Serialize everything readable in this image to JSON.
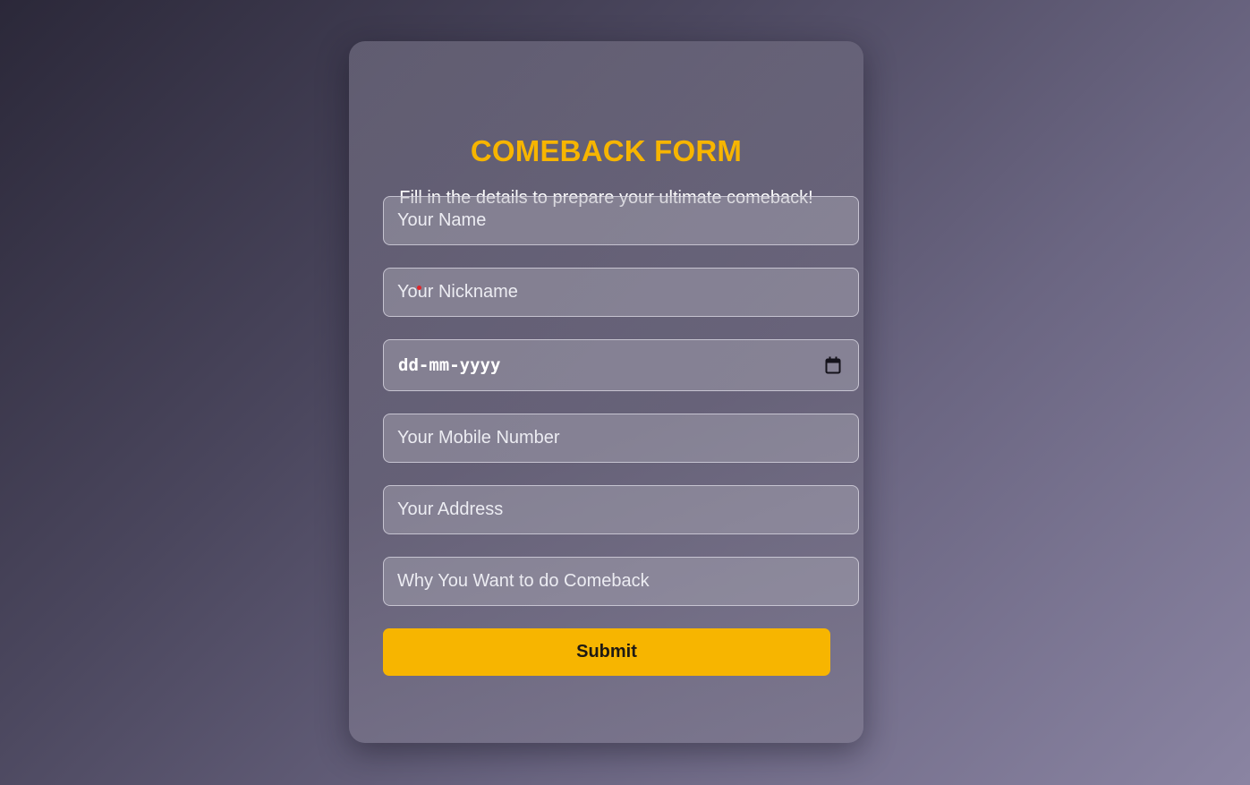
{
  "form": {
    "title": "COMEBACK FORM",
    "subtitle": "Fill in the details to prepare your ultimate comeback!",
    "fields": {
      "name_placeholder": "Your Name",
      "nickname_placeholder": "Your Nickname",
      "date_placeholder": "dd-mm-yyyy",
      "mobile_placeholder": "Your Mobile Number",
      "address_placeholder": "Your Address",
      "reason_placeholder": "Why You Want to do Comeback"
    },
    "submit_label": "Submit"
  },
  "colors": {
    "accent": "#f7b500",
    "text": "#ffffff",
    "button_text": "#1f1a14"
  },
  "icons": {
    "date_picker": "calendar-icon"
  }
}
